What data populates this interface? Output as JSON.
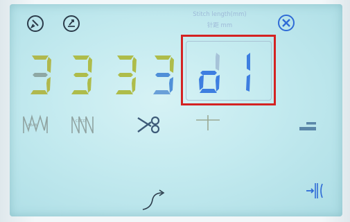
{
  "panel": {
    "stitch_length_label": "Stitch length(mm)",
    "stitch_length_label_cn": "针距 mm"
  },
  "display": {
    "digits": [
      "3",
      "3",
      "3",
      "3"
    ],
    "selected_code": [
      "d",
      "1"
    ]
  },
  "icons": {
    "top": [
      "needle-threader-icon",
      "presser-foot-icon",
      "tools-icon"
    ],
    "pattern_row": [
      "pattern-abab-icon",
      "pattern-cdcd-icon",
      "thread-trimmer-icon",
      "tack-stitch-icon",
      "presser-foot-level-icon"
    ],
    "bottom": [
      "reverse-stitch-icon",
      "needle-position-icon"
    ]
  },
  "colors": {
    "digit_olive": "#aebc4a",
    "digit_blue": "#3d7ee0",
    "selection_red": "#d42222",
    "icon_dark": "#2b3b4a",
    "icon_blue": "#2f6bd6"
  }
}
